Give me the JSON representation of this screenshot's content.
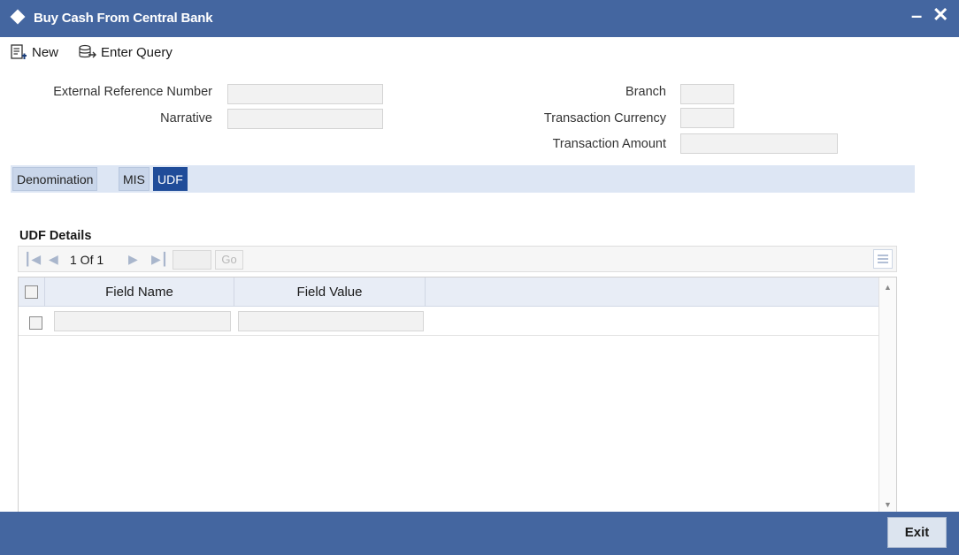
{
  "window": {
    "title": "Buy Cash From Central Bank",
    "minimize_label": "–",
    "close_label": "✕"
  },
  "toolbar": {
    "new_label": "New",
    "query_label": "Enter Query"
  },
  "form": {
    "ext_ref_label": "External Reference Number",
    "ext_ref_value": "",
    "narrative_label": "Narrative",
    "narrative_value": "",
    "branch_label": "Branch",
    "branch_value": "",
    "txn_currency_label": "Transaction Currency",
    "txn_currency_value": "",
    "txn_amount_label": "Transaction Amount",
    "txn_amount_value": ""
  },
  "tabs": [
    {
      "label": "Denomination",
      "active": false
    },
    {
      "label": "MIS",
      "active": false
    },
    {
      "label": "UDF",
      "active": true
    }
  ],
  "udf": {
    "section_title": "UDF Details",
    "pager": {
      "text": "1 Of 1",
      "go_label": "Go",
      "page_value": ""
    },
    "columns": [
      "Field Name",
      "Field Value"
    ],
    "rows": [
      {
        "field_name": "",
        "field_value": ""
      }
    ]
  },
  "footer": {
    "exit_label": "Exit"
  },
  "colors": {
    "header_bg": "#4466a0",
    "active_tab": "#1f4c99",
    "tab_strip": "#dde6f4"
  },
  "icons": [
    "diamond-icon",
    "new-doc-icon",
    "enter-query-icon",
    "first-page-icon",
    "prev-page-icon",
    "next-page-icon",
    "last-page-icon",
    "column-menu-icon"
  ]
}
